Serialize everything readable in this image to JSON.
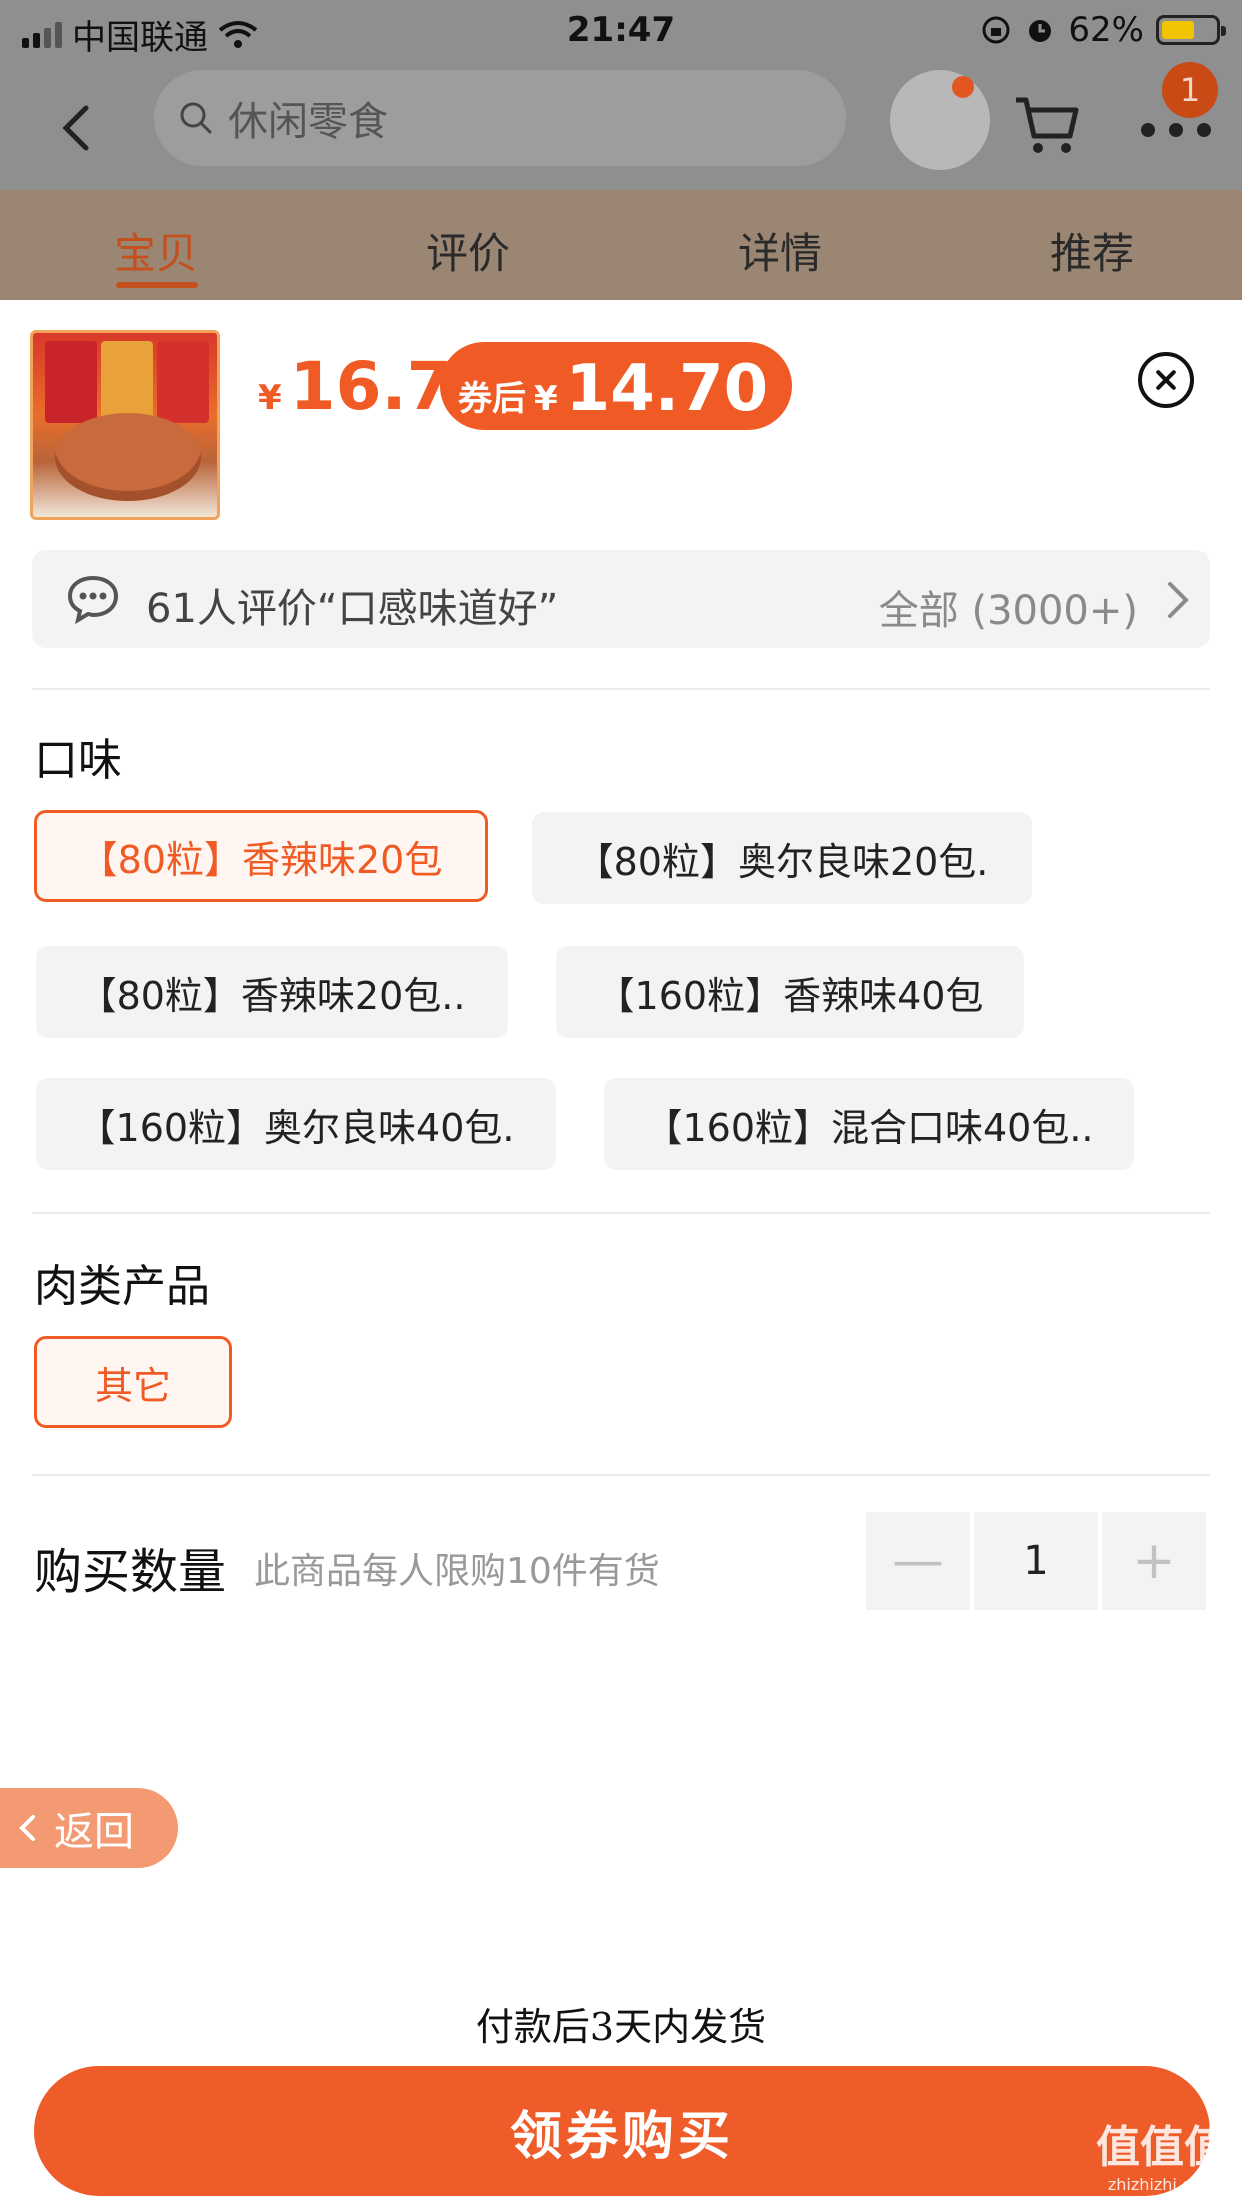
{
  "status_bar": {
    "carrier": "中国联通",
    "time": "21:47",
    "battery": "62%",
    "battery_level": 0.62
  },
  "nav": {
    "search_placeholder": "休闲零食",
    "badge_count": "1"
  },
  "tabs": [
    {
      "label": "宝贝",
      "active": true
    },
    {
      "label": "评价",
      "active": false
    },
    {
      "label": "详情",
      "active": false
    },
    {
      "label": "推荐",
      "active": false
    }
  ],
  "sheet": {
    "price_symbol": "¥",
    "price": "16.7",
    "coupon_label": "券后",
    "coupon_price": "14.70",
    "review_summary": "61人评价“口感味道好”",
    "review_all": "全部 (3000+)",
    "flavor_title": "口味",
    "flavors": [
      {
        "label": "【80粒】香辣味20包",
        "selected": true
      },
      {
        "label": "【80粒】奥尔良味20包.",
        "selected": false
      },
      {
        "label": "【80粒】香辣味20包..",
        "selected": false
      },
      {
        "label": "【160粒】香辣味40包",
        "selected": false
      },
      {
        "label": "【160粒】奥尔良味40包.",
        "selected": false
      },
      {
        "label": "【160粒】混合口味40包..",
        "selected": false
      }
    ],
    "meat_title": "肉类产品",
    "meat_option": "其它",
    "qty_label": "购买数量",
    "qty_note": "此商品每人限购10件有货",
    "qty_minus": "—",
    "qty_value": "1",
    "qty_plus": "+",
    "return_label": "返回",
    "ship_note": "付款后3天内发货",
    "buy_label": "领券购买"
  },
  "watermark": {
    "text": "值值值",
    "url": "zhizhizhi.com"
  },
  "colors": {
    "accent": "#f05a24",
    "button": "#ee5c2a"
  }
}
